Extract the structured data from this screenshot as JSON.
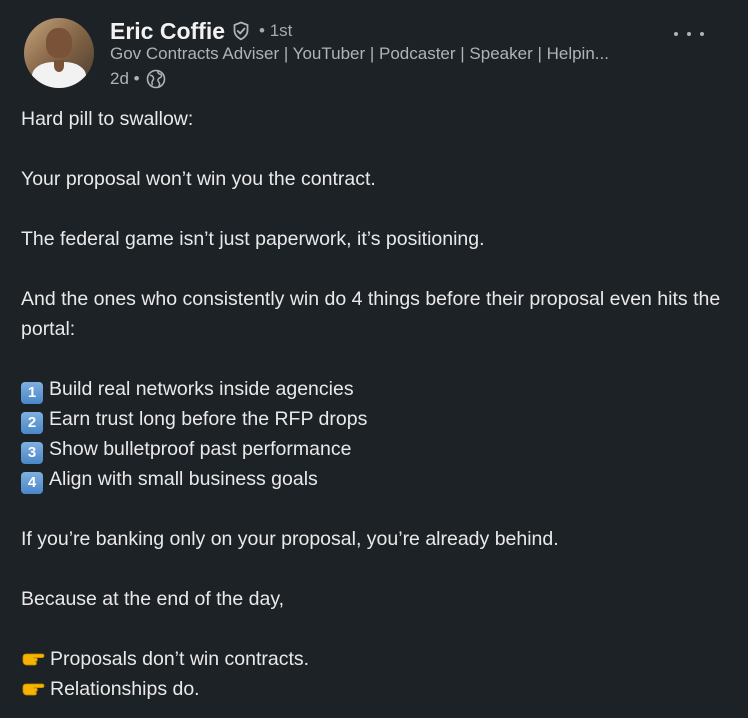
{
  "author": {
    "name": "Eric Coffie",
    "degree": "• 1st",
    "headline": "Gov Contracts Adviser | YouTuber | Podcaster | Speaker | Helpin...",
    "time": "2d •"
  },
  "post": {
    "p1": "Hard pill to swallow:",
    "p2": "Your proposal won’t win you the contract.",
    "p3": "The federal game isn’t just paperwork, it’s positioning.",
    "p4": "And the ones who consistently win do 4 things before their proposal even hits the portal:",
    "list": [
      {
        "num": "1",
        "text": "Build real networks inside agencies"
      },
      {
        "num": "2",
        "text": "Earn trust long before the RFP drops"
      },
      {
        "num": "3",
        "text": "Show bulletproof past performance"
      },
      {
        "num": "4",
        "text": "Align with small business goals"
      }
    ],
    "p5": "If you’re banking only on your proposal, you’re already behind.",
    "p6": "Because at the end of the day,",
    "closing": [
      {
        "icon": "pointing-hand-icon",
        "text": "Proposals don’t win contracts."
      },
      {
        "icon": "pointing-hand-icon",
        "text": "Relationships do."
      }
    ]
  },
  "icons": {
    "verified": "verified-badge-icon",
    "visibility": "globe-icon",
    "more": "more-options-icon"
  },
  "colors": {
    "background": "#1d2226",
    "text": "#e9e9e9",
    "muted": "#b0b3b6",
    "number_badge": "#4a86c8"
  }
}
